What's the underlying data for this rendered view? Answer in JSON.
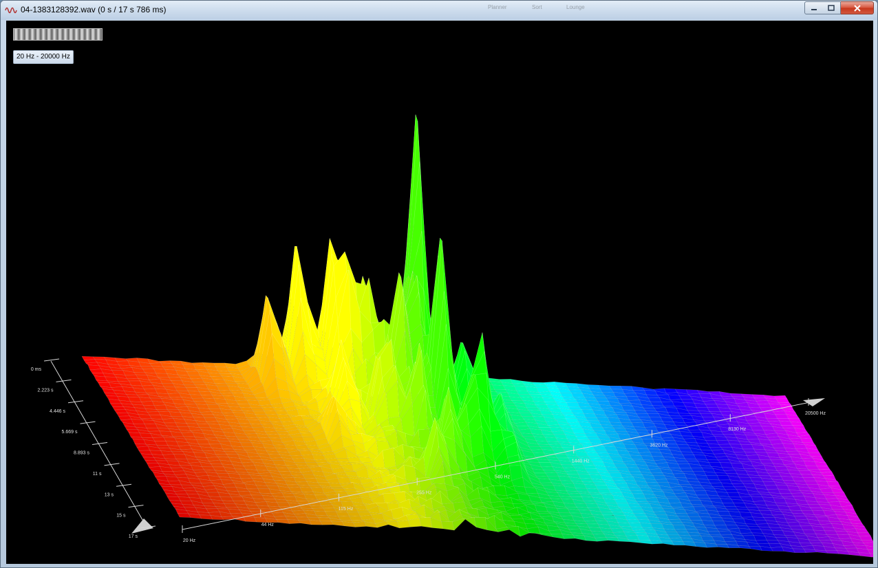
{
  "window": {
    "title": "04-1383128392.wav (0 s / 17 s 786 ms)",
    "icon": "waveform-icon",
    "controls": [
      "minimize-icon",
      "maximize-icon",
      "close-icon"
    ]
  },
  "background_toolbar": {
    "items": [
      "Planner",
      "Sort",
      "Lounge"
    ]
  },
  "view": {
    "frequency_range_button": "20 Hz - 20000 Hz"
  },
  "chart_data": {
    "type": "3d-surface",
    "x_axis": {
      "quantity": "frequency",
      "scale": "log",
      "ticks": [
        "20 Hz",
        "44 Hz",
        "115 Hz",
        "255 Hz",
        "540 Hz",
        "1440 Hz",
        "3620 Hz",
        "8130 Hz",
        "20500 Hz"
      ]
    },
    "y_axis": {
      "quantity": "time",
      "ticks": [
        "0 ms",
        "2.223 s",
        "4.446 s",
        "5.669 s",
        "8.893 s",
        "11 s",
        "13 s",
        "15 s",
        "17 s"
      ]
    },
    "colors": [
      "#ff0000",
      "#ff8000",
      "#ffff00",
      "#00ff00",
      "#00ffff",
      "#0000ff",
      "#ff00ff"
    ],
    "grid": true
  }
}
